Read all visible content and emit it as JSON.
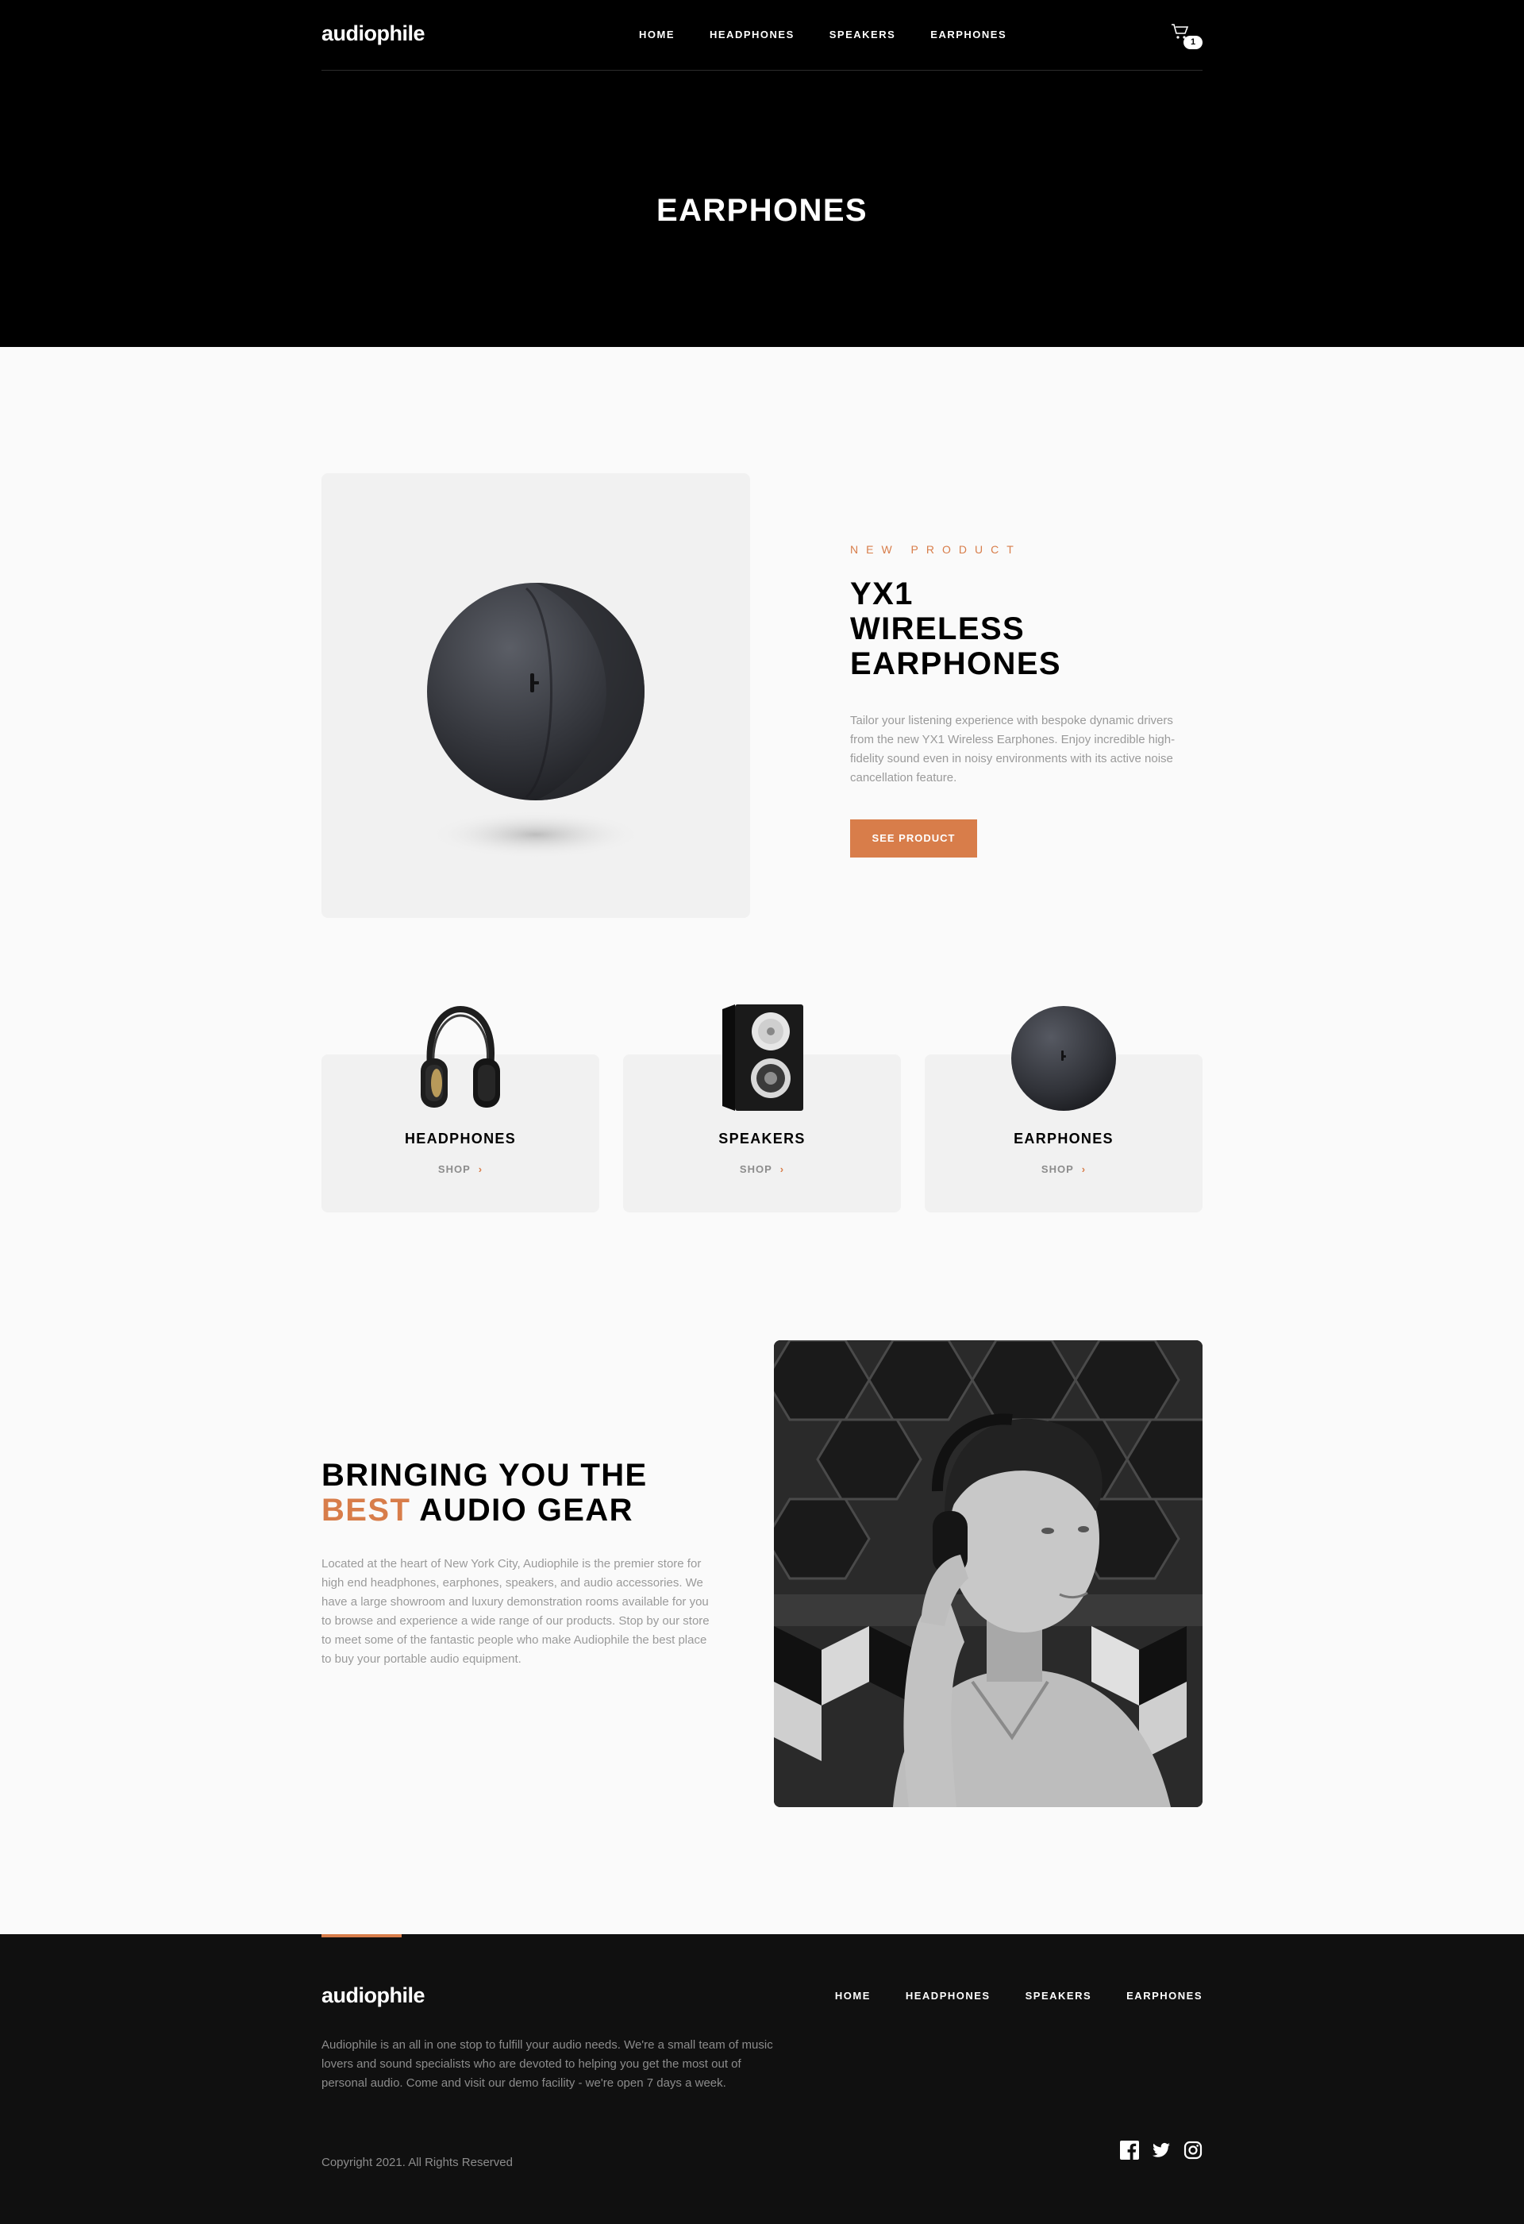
{
  "brand": {
    "logo": "audiophile",
    "accent_color": "#d87d4a"
  },
  "nav": {
    "home": "HOME",
    "headphones": "HEADPHONES",
    "speakers": "SPEAKERS",
    "earphones": "EARPHONES"
  },
  "cart": {
    "icon": "cart-icon",
    "count": "1"
  },
  "page": {
    "title": "EARPHONES"
  },
  "product": {
    "overline": "NEW PRODUCT",
    "name_line1": "YX1",
    "name_line2": "WIRELESS",
    "name_line3": "EARPHONES",
    "description": "Tailor your listening experience with bespoke dynamic drivers from the new YX1 Wireless Earphones. Enjoy incredible high-fidelity sound even in noisy environments with its active noise cancellation feature.",
    "button": "SEE PRODUCT"
  },
  "categories": [
    {
      "title": "HEADPHONES",
      "shop": "SHOP"
    },
    {
      "title": "SPEAKERS",
      "shop": "SHOP"
    },
    {
      "title": "EARPHONES",
      "shop": "SHOP"
    }
  ],
  "about": {
    "title_line1": "BRINGING YOU THE",
    "title_accent": "BEST",
    "title_rest": " AUDIO GEAR",
    "description": "Located at the heart of New York City, Audiophile is the premier store for high end headphones, earphones, speakers, and audio accessories. We have a large showroom and luxury demonstration rooms available for you to browse and experience a wide range of our products. Stop by our store to meet some of the fantastic people who make Audiophile the best place to buy your portable audio equipment."
  },
  "footer": {
    "logo": "audiophile",
    "links": {
      "home": "HOME",
      "headphones": "HEADPHONES",
      "speakers": "SPEAKERS",
      "earphones": "EARPHONES"
    },
    "description": "Audiophile is an all in one stop to fulfill your audio needs. We're a small team of music lovers and sound specialists who are devoted to helping you get the most out of personal audio. Come and visit our demo facility - we're open 7 days a week.",
    "copyright": "Copyright 2021. All Rights Reserved",
    "socials": [
      "facebook-icon",
      "twitter-icon",
      "instagram-icon"
    ]
  }
}
